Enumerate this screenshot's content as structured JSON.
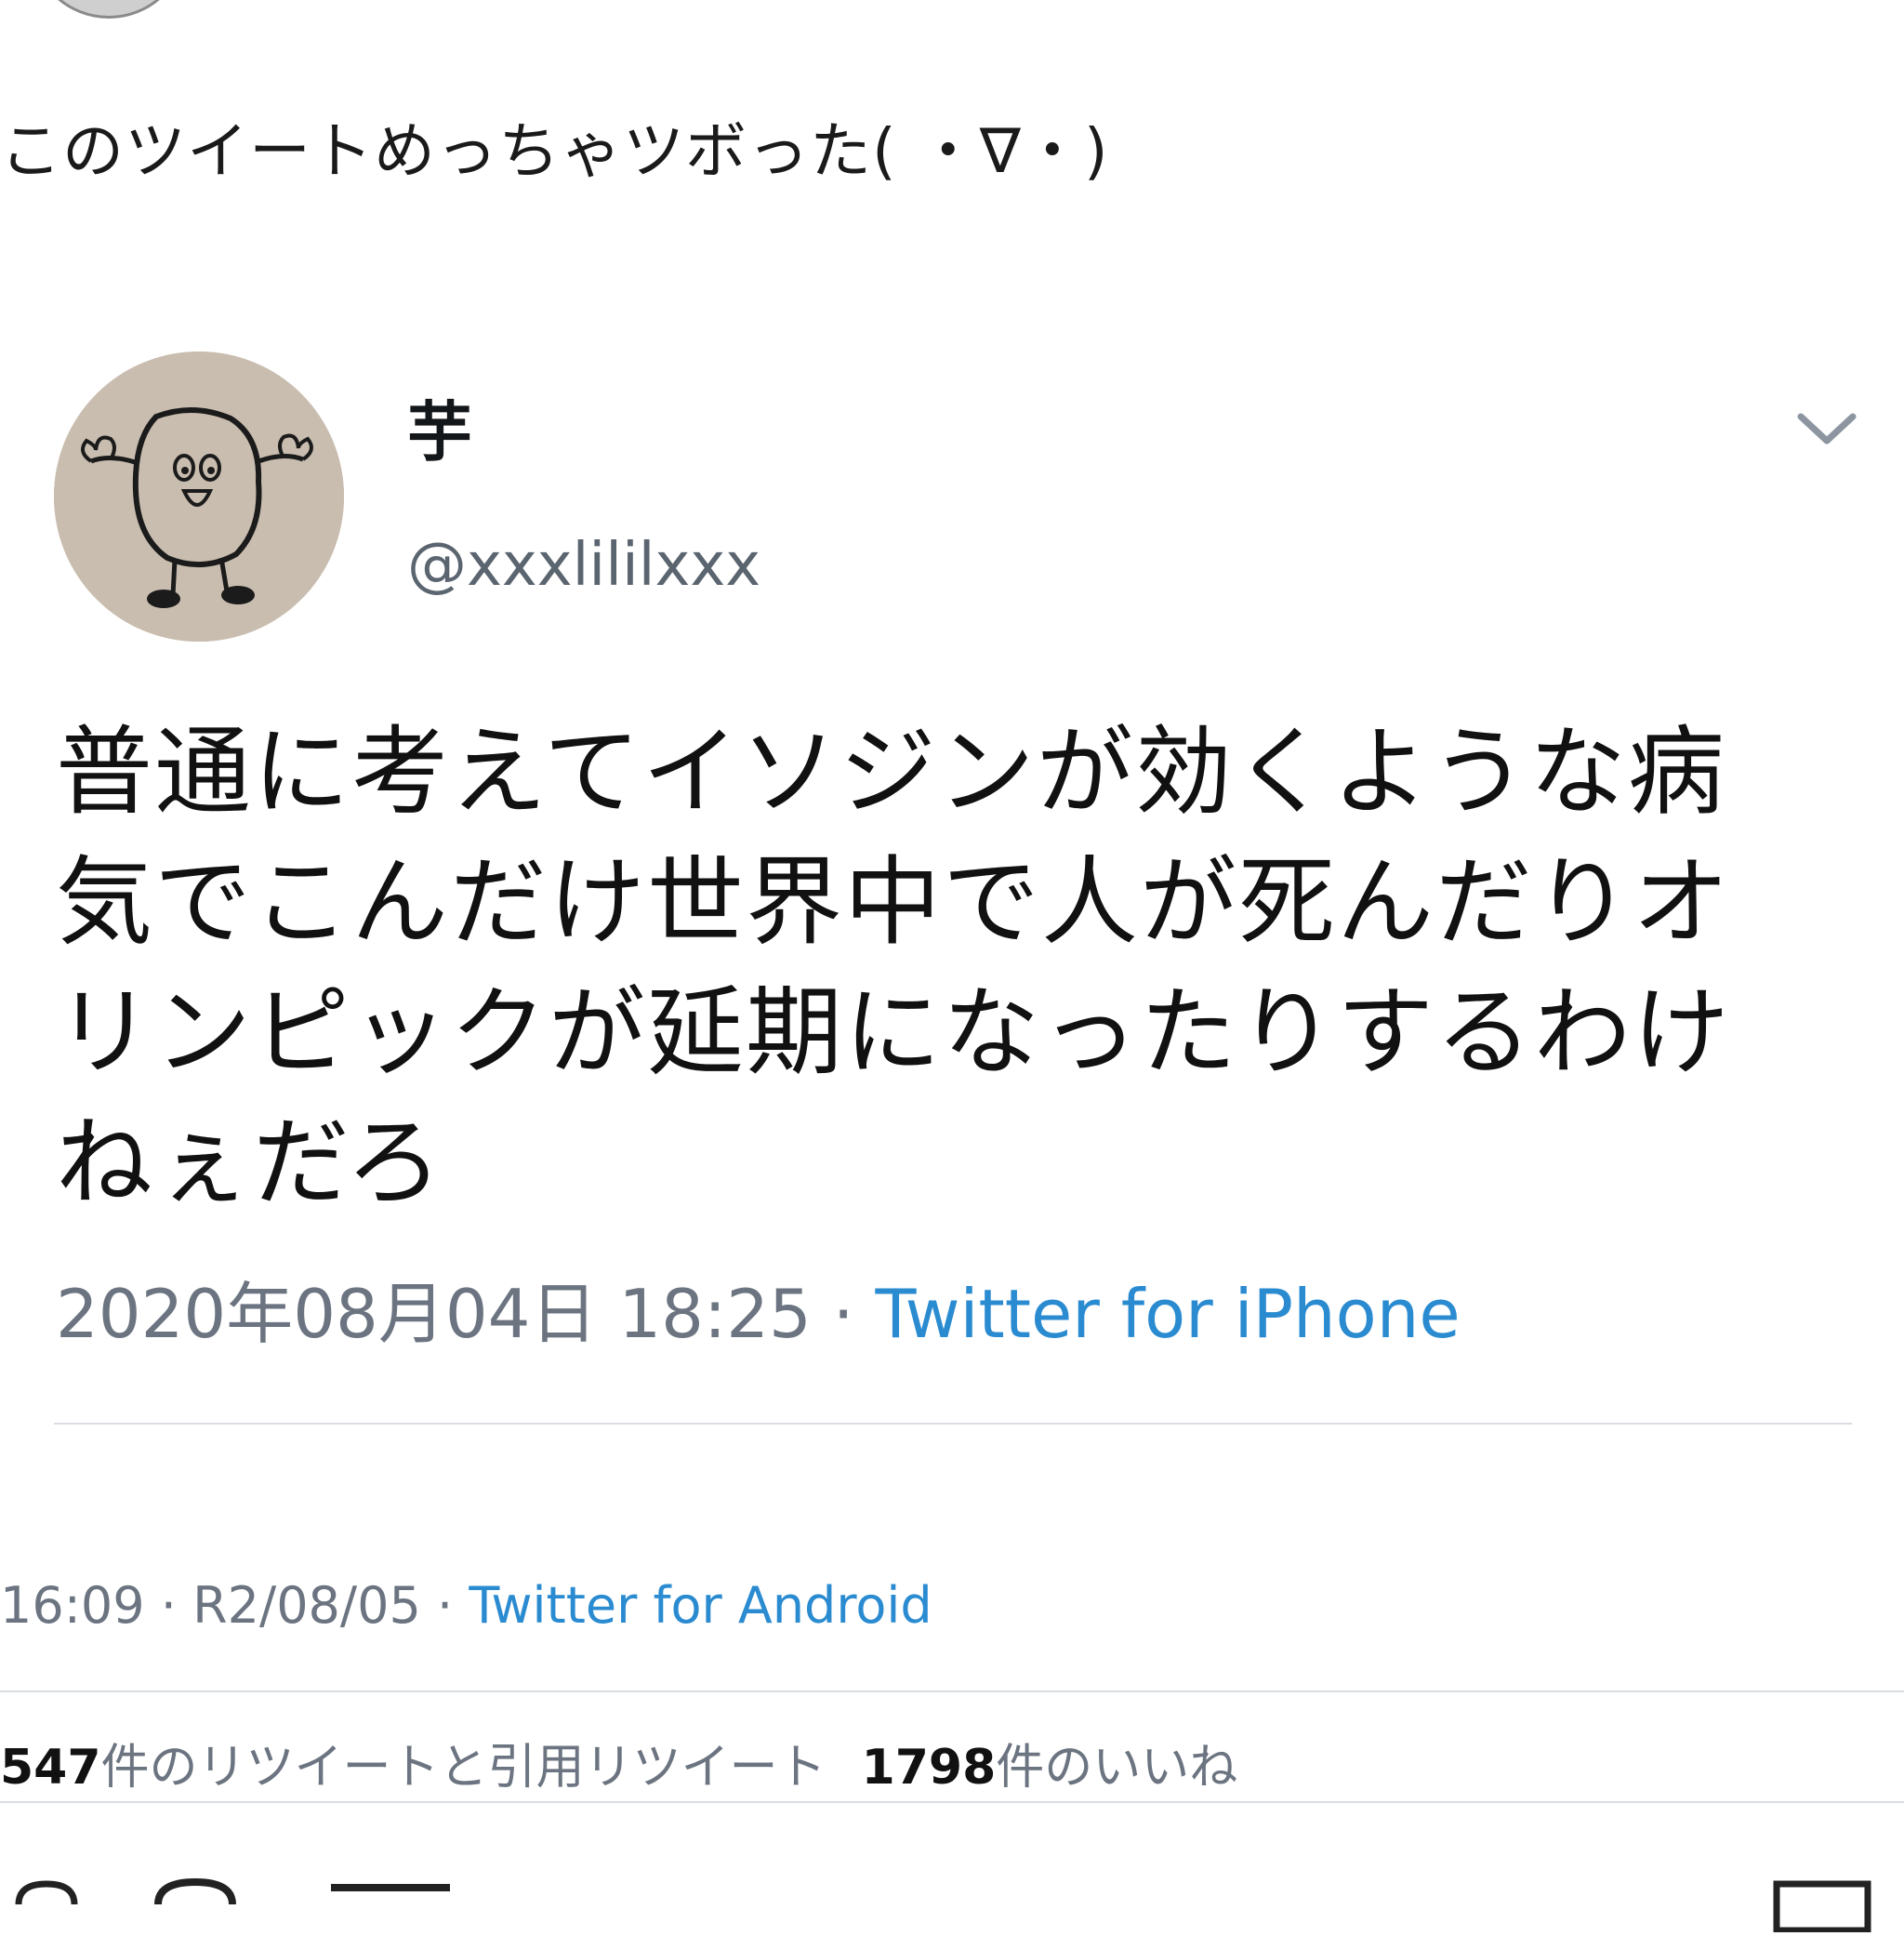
{
  "quote": {
    "comment": "このツイートめっちゃツボった( ・∇・)"
  },
  "embedded_tweet": {
    "display_name": "芋",
    "handle": "@xxxlililxxx",
    "text": "普通に考えてイソジンが効くような病\n気でこんだけ世界中で人が死んだりオ\nリンピックが延期になったりするわけ\nねぇだろ",
    "timestamp": "2020年08月04日 18:25",
    "separator": " · ",
    "source": "Twitter for iPhone"
  },
  "outer_tweet": {
    "time": "16:09",
    "date": "R2/08/05",
    "separator": " · ",
    "source": "Twitter for Android"
  },
  "stats": {
    "retweets_count": "547",
    "retweets_label": "件のリツイートと引用リツイート",
    "likes_count": "1798",
    "likes_label": "件のいいね"
  },
  "icons": {
    "chevron": "chevron-down-icon",
    "reply": "reply-icon",
    "retweet": "retweet-icon",
    "like": "like-icon",
    "share": "share-icon"
  },
  "colors": {
    "link": "#2a8bd1",
    "muted": "#6b7480",
    "divider": "#d9dde1"
  }
}
